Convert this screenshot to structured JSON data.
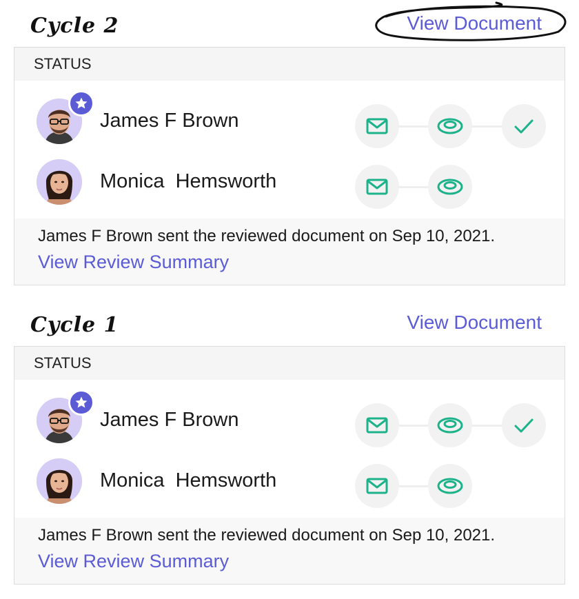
{
  "cycles": [
    {
      "title": "Cycle 2",
      "view_document": "View Document",
      "status_label": "STATUS",
      "participants": [
        {
          "name": "James F Brown",
          "role": "owner-star",
          "steps": [
            "sent",
            "viewed",
            "reviewed"
          ]
        },
        {
          "name": "Monica  Hemsworth",
          "role": "reviewer",
          "steps": [
            "sent",
            "viewed"
          ]
        }
      ],
      "summary_text": "James F Brown sent the reviewed document on Sep 10, 2021.",
      "summary_link": "View Review Summary"
    },
    {
      "title": "Cycle 1",
      "view_document": "View Document",
      "status_label": "STATUS",
      "participants": [
        {
          "name": "James F Brown",
          "role": "owner-star",
          "steps": [
            "sent",
            "viewed",
            "reviewed"
          ]
        },
        {
          "name": "Monica  Hemsworth",
          "role": "reviewer",
          "steps": [
            "sent",
            "viewed"
          ]
        }
      ],
      "summary_text": "James F Brown sent the reviewed document on Sep 10, 2021.",
      "summary_link": "View Review Summary"
    }
  ],
  "icons": {
    "sent": "mail-icon",
    "viewed": "eye-icon",
    "reviewed": "check-icon",
    "badge": "star-icon"
  },
  "colors": {
    "accent": "#5b5bd6",
    "success": "#1db38a",
    "avatar_bg": "#d6cdf6"
  }
}
